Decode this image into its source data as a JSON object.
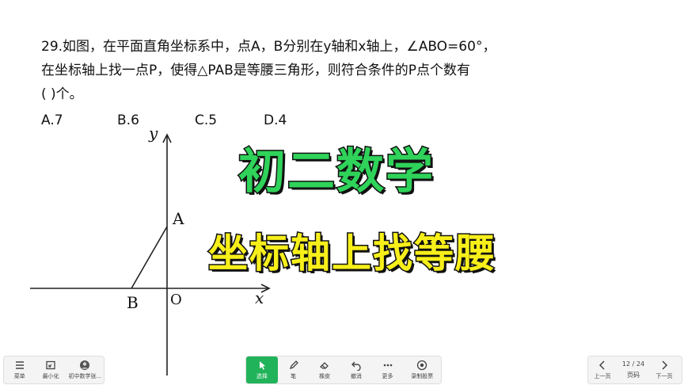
{
  "question": {
    "line1": "29.如图，在平面直角坐标系中，点A，B分别在y轴和x轴上，∠ABO=60°，",
    "line2": "在坐标轴上找一点P，使得△PAB是等腰三角形，则符合条件的P点个数有",
    "line3": "(    )个。"
  },
  "options": [
    "A.7",
    "B.6",
    "C.5",
    "D.4"
  ],
  "figure": {
    "y_label": "y",
    "x_label": "x",
    "point_a": "A",
    "point_b": "B",
    "origin": "O"
  },
  "overlay": {
    "title": "初二数学",
    "subtitle": "坐标轴上找等腰"
  },
  "toolbar_left": {
    "menu": "菜单",
    "minimize": "最小化",
    "app": "初中数学张..."
  },
  "toolbar_center": {
    "select": "选择",
    "pen": "笔",
    "eraser": "橡皮",
    "undo": "撤消",
    "more": "更多",
    "record": "录制股票"
  },
  "toolbar_right": {
    "prev": "上一页",
    "page_indicator": "12 / 24",
    "page_label": "页码",
    "next": "下一页"
  },
  "colors": {
    "title_green": "#2fd35a",
    "subtitle_yellow": "#f7ef1a",
    "select_active": "#21b35a"
  }
}
